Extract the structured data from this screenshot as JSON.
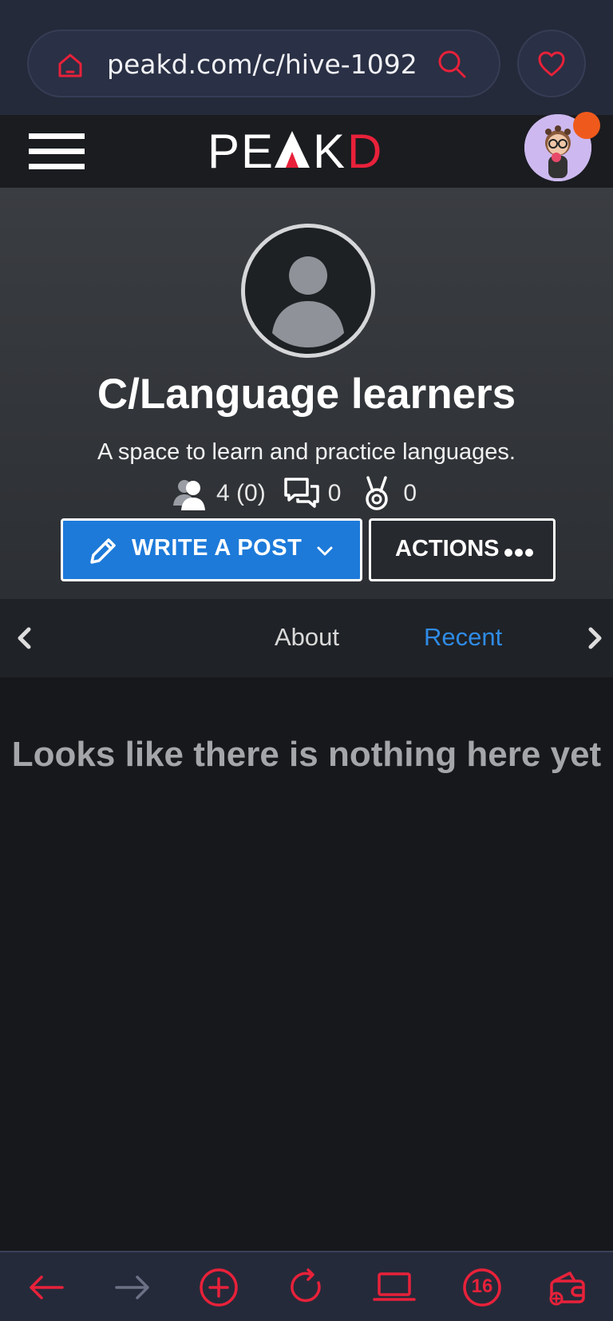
{
  "browser": {
    "url": "peakd.com/c/hive-1092",
    "tab_count": "16"
  },
  "header": {
    "logo_text": "PEAKD"
  },
  "community": {
    "title": "C/Language learners",
    "description": "A space to learn and practice languages.",
    "stats": {
      "subscribers": "4 (0)",
      "posts": "0",
      "rewards": "0"
    },
    "write_label": "WRITE A POST",
    "actions_label": "ACTIONS"
  },
  "tabs": {
    "items": [
      {
        "label": "About"
      },
      {
        "label": "Recent"
      }
    ],
    "active": "Recent"
  },
  "content": {
    "empty_message": "Looks like there is nothing here yet"
  },
  "colors": {
    "accent_red": "#e8213a",
    "accent_blue": "#1d7ad9",
    "active_tab": "#2f8be6",
    "notification": "#ef5a1c"
  },
  "icons": [
    "home-icon",
    "search-icon",
    "heart-icon",
    "hamburger-icon",
    "user-group-icon",
    "chat-icon",
    "medal-icon",
    "pencil-icon",
    "chevron-down-icon",
    "more-dots-icon",
    "chevron-left-icon",
    "chevron-right-icon",
    "back-arrow-icon",
    "forward-arrow-icon",
    "new-tab-icon",
    "reload-icon",
    "desktop-icon",
    "tabs-icon",
    "wallet-icon"
  ]
}
